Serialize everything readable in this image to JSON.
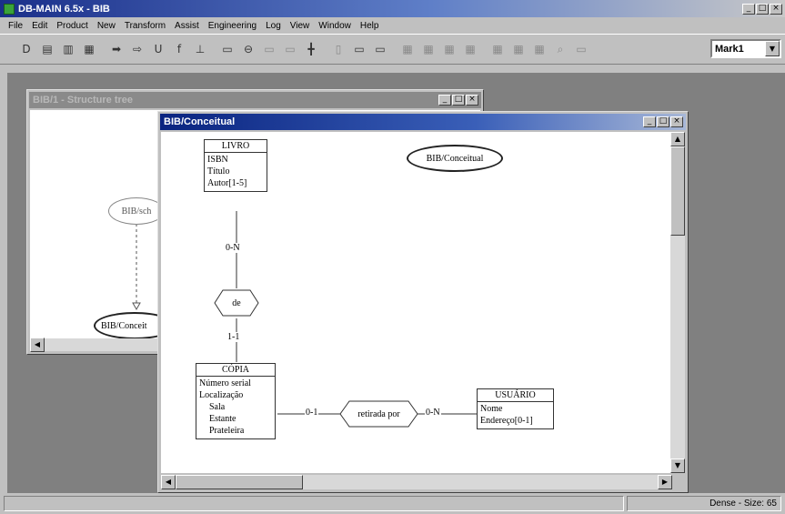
{
  "app": {
    "title": "DB-MAIN 6.5x - BIB",
    "min_glyph": "_",
    "max_glyph": "□",
    "close_glyph": "×"
  },
  "menu": [
    "File",
    "Edit",
    "Product",
    "New",
    "Transform",
    "Assist",
    "Engineering",
    "Log",
    "View",
    "Window",
    "Help"
  ],
  "toolbar": {
    "icons": [
      {
        "name": "new-icon",
        "glyph": "D",
        "enabled": true
      },
      {
        "name": "open-icon",
        "glyph": "▤",
        "enabled": true
      },
      {
        "name": "copy-icon",
        "glyph": "▥",
        "enabled": true
      },
      {
        "name": "paste-icon",
        "glyph": "▦",
        "enabled": true
      },
      {
        "name": "sep"
      },
      {
        "name": "arrow-right-icon",
        "glyph": "➡",
        "enabled": true
      },
      {
        "name": "transform-icon",
        "glyph": "⇨",
        "enabled": true
      },
      {
        "name": "undo-icon",
        "glyph": "U",
        "enabled": true
      },
      {
        "name": "function-icon",
        "glyph": "f",
        "enabled": true
      },
      {
        "name": "text-tool-icon",
        "glyph": "⊥",
        "enabled": true
      },
      {
        "name": "sep"
      },
      {
        "name": "entity-icon",
        "glyph": "▭",
        "enabled": true
      },
      {
        "name": "rel-icon",
        "glyph": "⊖",
        "enabled": true
      },
      {
        "name": "attr-icon",
        "glyph": "▭",
        "enabled": false
      },
      {
        "name": "group-icon",
        "glyph": "▭",
        "enabled": false
      },
      {
        "name": "link-icon",
        "glyph": "╋",
        "enabled": true
      },
      {
        "name": "sep"
      },
      {
        "name": "note-icon",
        "glyph": "▯",
        "enabled": false
      },
      {
        "name": "align-icon",
        "glyph": "▭",
        "enabled": true
      },
      {
        "name": "box-icon",
        "glyph": "▭",
        "enabled": true
      },
      {
        "name": "sep"
      },
      {
        "name": "grid-icon",
        "glyph": "▦",
        "enabled": false
      },
      {
        "name": "grid2-icon",
        "glyph": "▦",
        "enabled": false
      },
      {
        "name": "grid3-icon",
        "glyph": "▦",
        "enabled": false
      },
      {
        "name": "grid4-icon",
        "glyph": "▦",
        "enabled": false
      },
      {
        "name": "sep"
      },
      {
        "name": "table-icon",
        "glyph": "▦",
        "enabled": false
      },
      {
        "name": "table2-icon",
        "glyph": "▦",
        "enabled": false
      },
      {
        "name": "table3-icon",
        "glyph": "▦",
        "enabled": false
      },
      {
        "name": "search-icon",
        "glyph": "⌕",
        "enabled": false
      },
      {
        "name": "mark-icon",
        "glyph": "▭",
        "enabled": false
      }
    ],
    "mark_select": "Mark1"
  },
  "back_window": {
    "title": "BIB/1 - Structure tree",
    "nodes": {
      "top": "BIB/sch",
      "bottom": "BIB/Conceit"
    }
  },
  "front_window": {
    "title": "BIB/Conceitual",
    "schema_label": "BIB/Conceitual",
    "entities": {
      "livro": {
        "name": "LIVRO",
        "attrs": [
          "ISBN",
          "Título",
          "Autor[1-5]"
        ]
      },
      "copia": {
        "name": "CÓPIA",
        "attrs": [
          "Número serial",
          "Localização",
          "Sala",
          "Estante",
          "Prateleira"
        ]
      },
      "usuario": {
        "name": "USUÁRIO",
        "attrs": [
          "Nome",
          "Endereço[0-1]"
        ]
      }
    },
    "relationships": {
      "de": "de",
      "retirada": "retirada por"
    },
    "cardinalities": {
      "livro_de": "0-N",
      "de_copia": "1-1",
      "copia_ret": "0-1",
      "ret_usuario": "0-N"
    }
  },
  "status": {
    "left": "",
    "right": "Dense - Size: 65"
  }
}
